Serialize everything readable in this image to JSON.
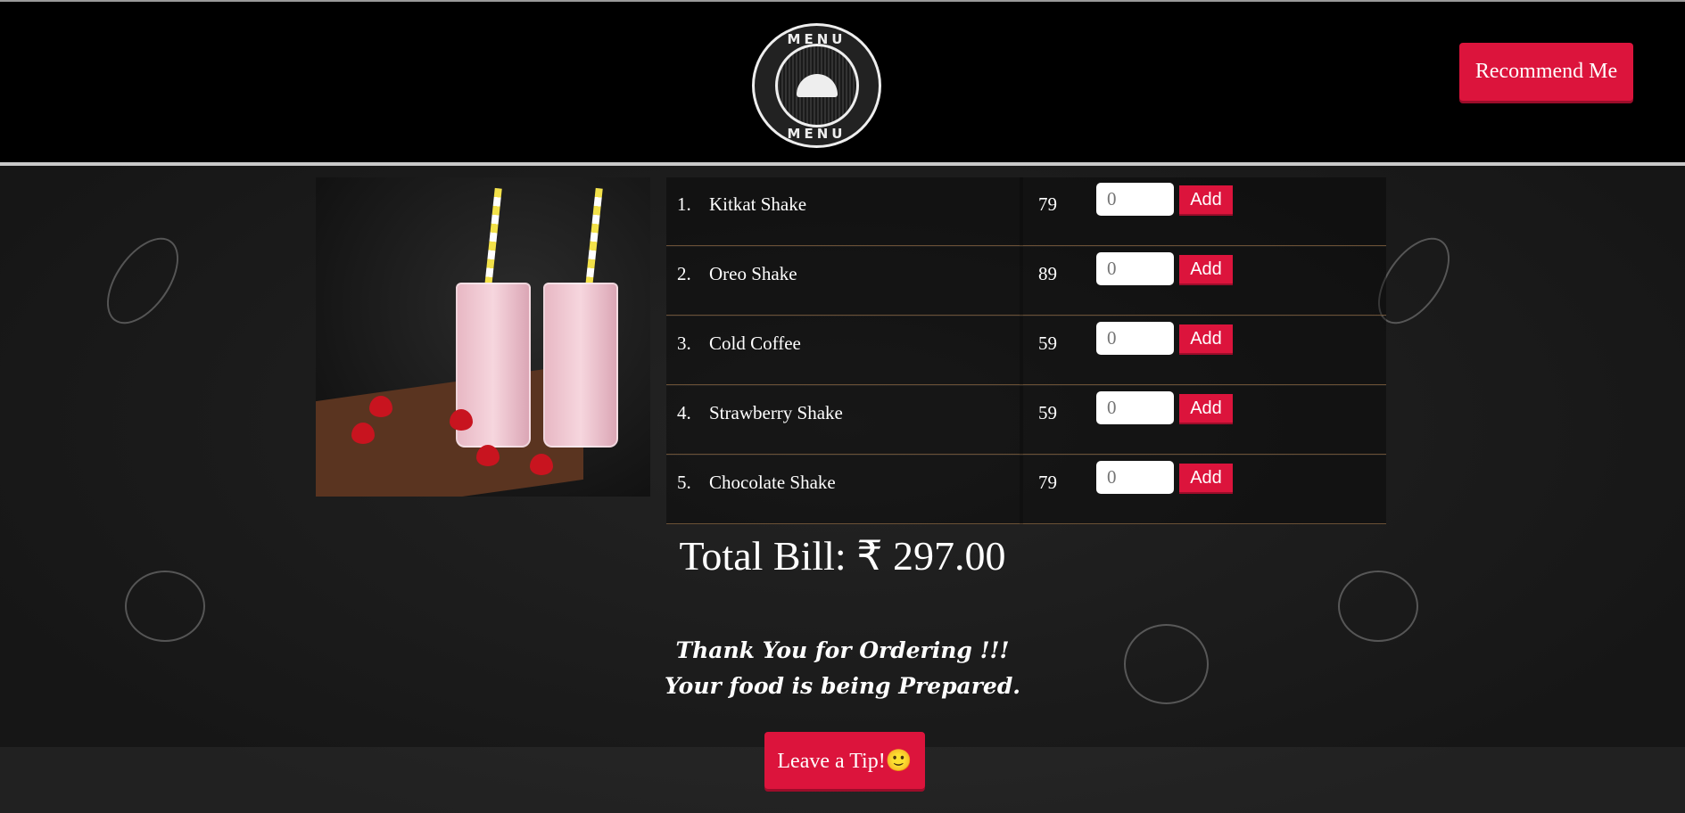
{
  "header": {
    "logo_text_top": "MENU",
    "logo_text_bottom": "MENU",
    "recommend_label": "Recommend Me"
  },
  "menu": {
    "items": [
      {
        "number": "1.",
        "name": "Kitkat Shake",
        "price": "79",
        "quantity_placeholder": "0",
        "add_label": "Add"
      },
      {
        "number": "2.",
        "name": "Oreo Shake",
        "price": "89",
        "quantity_placeholder": "0",
        "add_label": "Add"
      },
      {
        "number": "3.",
        "name": "Cold Coffee",
        "price": "59",
        "quantity_placeholder": "0",
        "add_label": "Add"
      },
      {
        "number": "4.",
        "name": "Strawberry Shake",
        "price": "59",
        "quantity_placeholder": "0",
        "add_label": "Add"
      },
      {
        "number": "5.",
        "name": "Chocolate Shake",
        "price": "79",
        "quantity_placeholder": "0",
        "add_label": "Add"
      }
    ]
  },
  "total": {
    "label": "Total Bill: ₹ 297.00"
  },
  "message": {
    "line1": "Thank You for Ordering !!!",
    "line2": "Your food is being Prepared."
  },
  "tip": {
    "label": "Leave a Tip!",
    "emoji": "🙂"
  },
  "colors": {
    "accent": "#dc143c",
    "header_bg": "#000000",
    "board": "#1d1d1d"
  }
}
